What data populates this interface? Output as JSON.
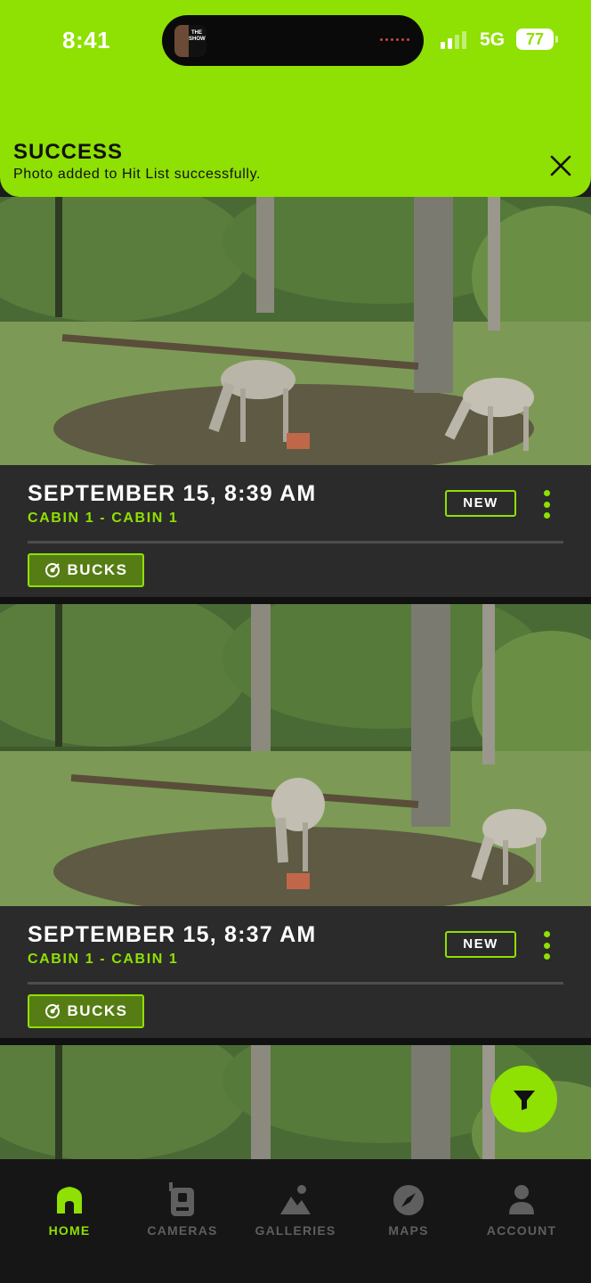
{
  "status_bar": {
    "time": "8:41",
    "network": "5G",
    "battery": "77",
    "live_activity_label": "THE SHOW"
  },
  "toast": {
    "title": "SUCCESS",
    "message": "Photo added to Hit List successfully.",
    "close_icon": "close-icon"
  },
  "colors": {
    "accent": "#8fe003",
    "card_bg": "#2b2b2b",
    "tag_bg": "#567d14",
    "tab_inactive": "#5f5f5f"
  },
  "feed": {
    "items": [
      {
        "date": "SEPTEMBER 15, 8:39 AM",
        "location": "CABIN 1 - CABIN 1",
        "badge": "NEW",
        "tag": "BUCKS"
      },
      {
        "date": "SEPTEMBER 15, 8:37 AM",
        "location": "CABIN 1 - CABIN 1",
        "badge": "NEW",
        "tag": "BUCKS"
      }
    ]
  },
  "fab": {
    "icon": "filter-icon"
  },
  "tabbar": {
    "items": [
      {
        "label": "HOME",
        "icon": "home-icon",
        "active": true
      },
      {
        "label": "CAMERAS",
        "icon": "camera-icon",
        "active": false
      },
      {
        "label": "GALLERIES",
        "icon": "mountains-icon",
        "active": false
      },
      {
        "label": "MAPS",
        "icon": "compass-icon",
        "active": false
      },
      {
        "label": "ACCOUNT",
        "icon": "person-icon",
        "active": false
      }
    ]
  }
}
